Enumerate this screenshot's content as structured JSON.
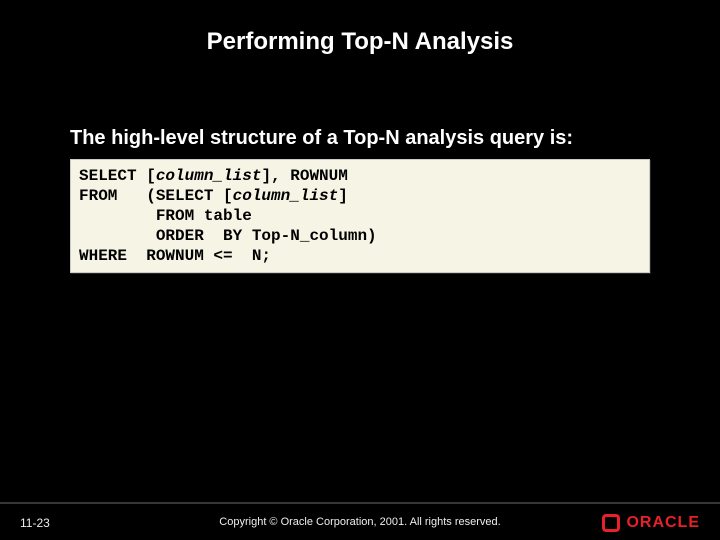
{
  "slide": {
    "title": "Performing Top-N Analysis",
    "body_text": "The high-level structure of a Top-N analysis query is:",
    "code": {
      "l1a": "SELECT [",
      "l1b": "column_list",
      "l1c": "], ROWNUM",
      "l2a": "FROM   (SELECT [",
      "l2b": "column_list",
      "l2c": "]",
      "l3": "        FROM table",
      "l4": "        ORDER  BY Top-N_column)",
      "l5": "WHERE  ROWNUM <=  N;"
    }
  },
  "footer": {
    "slide_number": "11-23",
    "copyright": "Copyright © Oracle Corporation, 2001. All rights reserved.",
    "logo_text": "ORACLE"
  },
  "colors": {
    "accent": "#e8202a",
    "code_bg": "#f6f4e4"
  }
}
